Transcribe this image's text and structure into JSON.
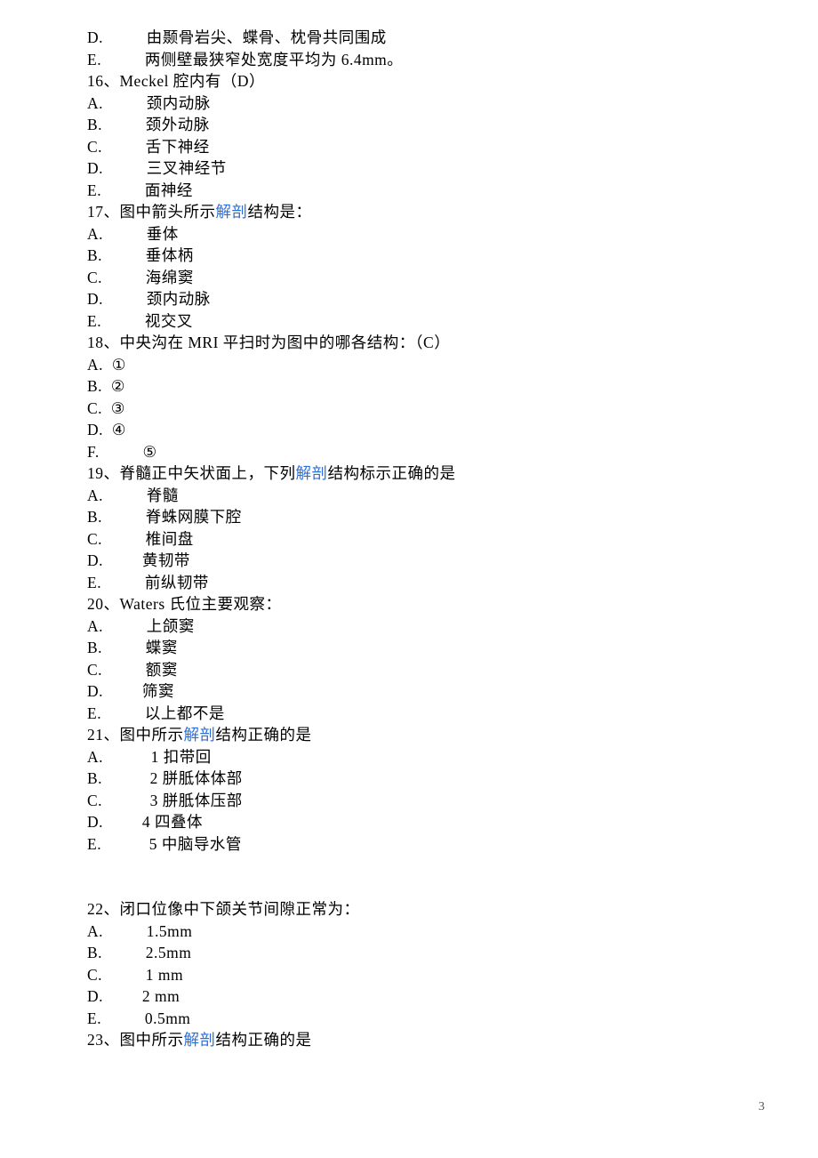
{
  "lines": [
    [
      [
        "D.          由颞骨岩尖、蝶骨、枕骨共同围成"
      ]
    ],
    [
      [
        "E.          两侧壁最狭窄处宽度平均为 6.4mm。"
      ]
    ],
    [
      [
        "16、Meckel 腔内有（D）"
      ]
    ],
    [
      [
        "A.          颈内动脉"
      ]
    ],
    [
      [
        "B.          颈外动脉"
      ]
    ],
    [
      [
        "C.          舌下神经"
      ]
    ],
    [
      [
        "D.          三叉神经节"
      ]
    ],
    [
      [
        "E.          面神经"
      ]
    ],
    [
      [
        "17、图中箭头所示"
      ],
      [
        "解剖",
        "link"
      ],
      [
        "结构是："
      ]
    ],
    [
      [
        "A.          垂体"
      ]
    ],
    [
      [
        "B.          垂体柄"
      ]
    ],
    [
      [
        "C.          海绵窦"
      ]
    ],
    [
      [
        "D.          颈内动脉"
      ]
    ],
    [
      [
        "E.          视交叉"
      ]
    ],
    [
      [
        "18、中央沟在 MRI 平扫时为图中的哪各结构：（C）"
      ]
    ],
    [
      [
        "A.  ①"
      ]
    ],
    [
      [
        "B.  ②"
      ]
    ],
    [
      [
        "C.  ③"
      ]
    ],
    [
      [
        "D.  ④"
      ]
    ],
    [
      [
        "F.          ⑤"
      ]
    ],
    [
      [
        "19、脊髓正中矢状面上，下列"
      ],
      [
        "解剖",
        "link"
      ],
      [
        "结构标示正确的是"
      ]
    ],
    [
      [
        "A.          脊髓"
      ]
    ],
    [
      [
        "B.          脊蛛网膜下腔"
      ]
    ],
    [
      [
        "C.          椎间盘"
      ]
    ],
    [
      [
        "D.         黄韧带"
      ]
    ],
    [
      [
        "E.          前纵韧带"
      ]
    ],
    [
      [
        "20、Waters 氏位主要观察："
      ]
    ],
    [
      [
        "A.          上颌窦"
      ]
    ],
    [
      [
        "B.          蝶窦"
      ]
    ],
    [
      [
        "C.          额窦"
      ]
    ],
    [
      [
        "D.         筛窦"
      ]
    ],
    [
      [
        "E.          以上都不是"
      ]
    ],
    [
      [
        "21、图中所示"
      ],
      [
        "解剖",
        "link"
      ],
      [
        "结构正确的是"
      ]
    ],
    [
      [
        "A.           1 扣带回"
      ]
    ],
    [
      [
        "B.           2 胼胝体体部"
      ]
    ],
    [
      [
        "C.           3 胼胝体压部"
      ]
    ],
    [
      [
        "D.         4 四叠体"
      ]
    ],
    [
      [
        "E.           5 中脑导水管"
      ]
    ],
    [
      [
        ""
      ]
    ],
    [
      [
        ""
      ]
    ],
    [
      [
        "22、闭口位像中下颌关节间隙正常为："
      ]
    ],
    [
      [
        "A.          1.5mm"
      ]
    ],
    [
      [
        "B.          2.5mm"
      ]
    ],
    [
      [
        "C.          1 mm"
      ]
    ],
    [
      [
        "D.         2 mm"
      ]
    ],
    [
      [
        "E.          0.5mm"
      ]
    ],
    [
      [
        "23、图中所示"
      ],
      [
        "解剖",
        "link"
      ],
      [
        "结构正确的是"
      ]
    ]
  ],
  "pageNumber": "3"
}
